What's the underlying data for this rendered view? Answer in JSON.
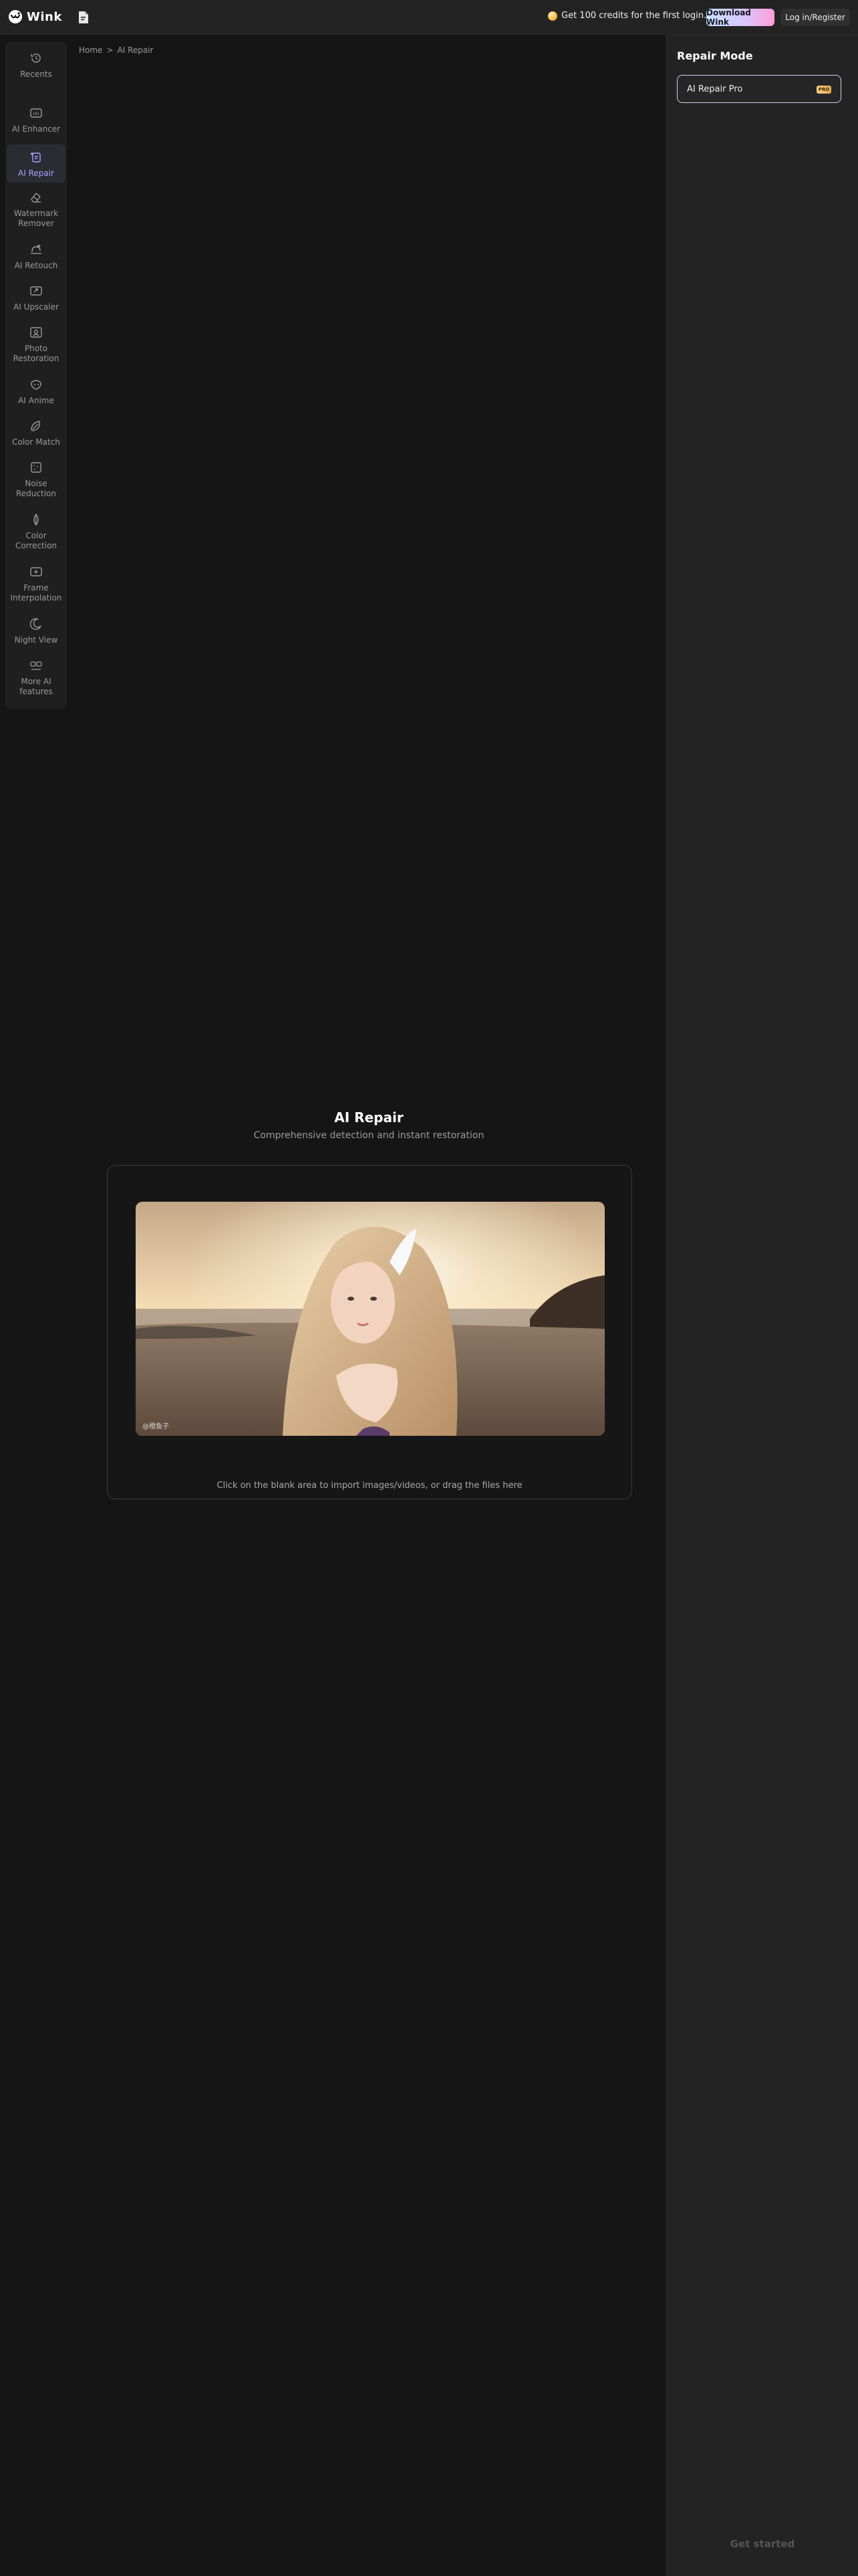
{
  "header": {
    "app_name": "Wink",
    "promo_text": "Get 100 credits for the first login.",
    "download_label": "Download Wink",
    "login_label": "Log in/Register"
  },
  "sidebar": {
    "items": [
      {
        "label": "Recents",
        "icon": "history-icon"
      },
      {
        "label": "AI Enhancer",
        "icon": "hd-icon"
      },
      {
        "label": "AI Repair",
        "icon": "sparkle-repair-icon",
        "active": true
      },
      {
        "label": "Watermark Remover",
        "icon": "eraser-icon"
      },
      {
        "label": "AI Retouch",
        "icon": "retouch-icon"
      },
      {
        "label": "AI Upscaler",
        "icon": "upscale-icon"
      },
      {
        "label": "Photo Restoration",
        "icon": "photo-icon"
      },
      {
        "label": "AI Anime",
        "icon": "anime-icon"
      },
      {
        "label": "Color Match",
        "icon": "color-match-icon"
      },
      {
        "label": "Noise Reduction",
        "icon": "noise-icon"
      },
      {
        "label": "Color Correction",
        "icon": "color-correction-icon"
      },
      {
        "label": "Frame Interpolation",
        "icon": "frame-icon"
      },
      {
        "label": "Night View",
        "icon": "moon-icon"
      },
      {
        "label": "More AI features",
        "icon": "more-features-icon"
      }
    ]
  },
  "breadcrumb": {
    "home": "Home",
    "separator": ">",
    "current": "AI Repair"
  },
  "main": {
    "title": "AI Repair",
    "subtitle": "Comprehensive detection and instant restoration",
    "watermark": "@橙鱼子",
    "drop_hint": "Click on the blank area to import images/videos, or drag the files here"
  },
  "right_panel": {
    "title": "Repair Mode",
    "mode_label": "AI Repair Pro",
    "mode_badge": "PRO",
    "get_started_label": "Get started"
  },
  "colors": {
    "background": "#151515",
    "panel": "#232323",
    "accent_active": "#a9a3ff",
    "pro_badge": "#e5a84a"
  }
}
